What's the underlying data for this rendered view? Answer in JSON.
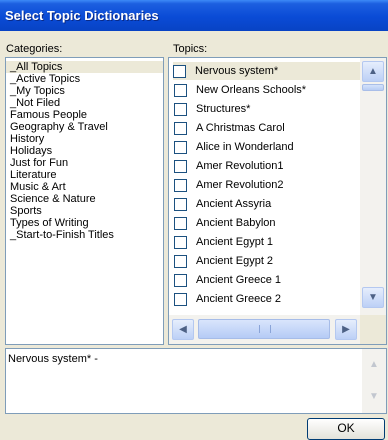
{
  "window": {
    "title": "Select Topic Dictionaries"
  },
  "categories": {
    "label": "Categories:",
    "items": [
      {
        "label": "_All Topics",
        "selected": true
      },
      {
        "label": "_Active Topics"
      },
      {
        "label": "_My Topics"
      },
      {
        "label": "_Not Filed"
      },
      {
        "label": "Famous People"
      },
      {
        "label": "Geography & Travel"
      },
      {
        "label": "History"
      },
      {
        "label": "Holidays"
      },
      {
        "label": "Just for Fun"
      },
      {
        "label": "Literature"
      },
      {
        "label": "Music & Art"
      },
      {
        "label": "Science & Nature"
      },
      {
        "label": "Sports"
      },
      {
        "label": "Types of Writing"
      },
      {
        "label": "_Start-to-Finish Titles"
      }
    ]
  },
  "topics": {
    "label": "Topics:",
    "items": [
      {
        "label": "Nervous system*",
        "checked": false,
        "selected": true
      },
      {
        "label": "New Orleans Schools*",
        "checked": false
      },
      {
        "label": "Structures*",
        "checked": false
      },
      {
        "label": "A Christmas Carol",
        "checked": false
      },
      {
        "label": "Alice in Wonderland",
        "checked": false
      },
      {
        "label": "Amer Revolution1",
        "checked": false
      },
      {
        "label": "Amer Revolution2",
        "checked": false
      },
      {
        "label": "Ancient Assyria",
        "checked": false
      },
      {
        "label": "Ancient Babylon",
        "checked": false
      },
      {
        "label": "Ancient Egypt 1",
        "checked": false
      },
      {
        "label": "Ancient Egypt 2",
        "checked": false
      },
      {
        "label": "Ancient Greece 1",
        "checked": false
      },
      {
        "label": "Ancient Greece 2",
        "checked": false
      }
    ]
  },
  "description": {
    "text": "Nervous system* -"
  },
  "buttons": {
    "ok": "OK"
  },
  "icons": {
    "scroll_up": "chevron-up-icon",
    "scroll_down": "chevron-down-icon",
    "scroll_left": "chevron-left-icon",
    "scroll_right": "chevron-right-icon"
  }
}
